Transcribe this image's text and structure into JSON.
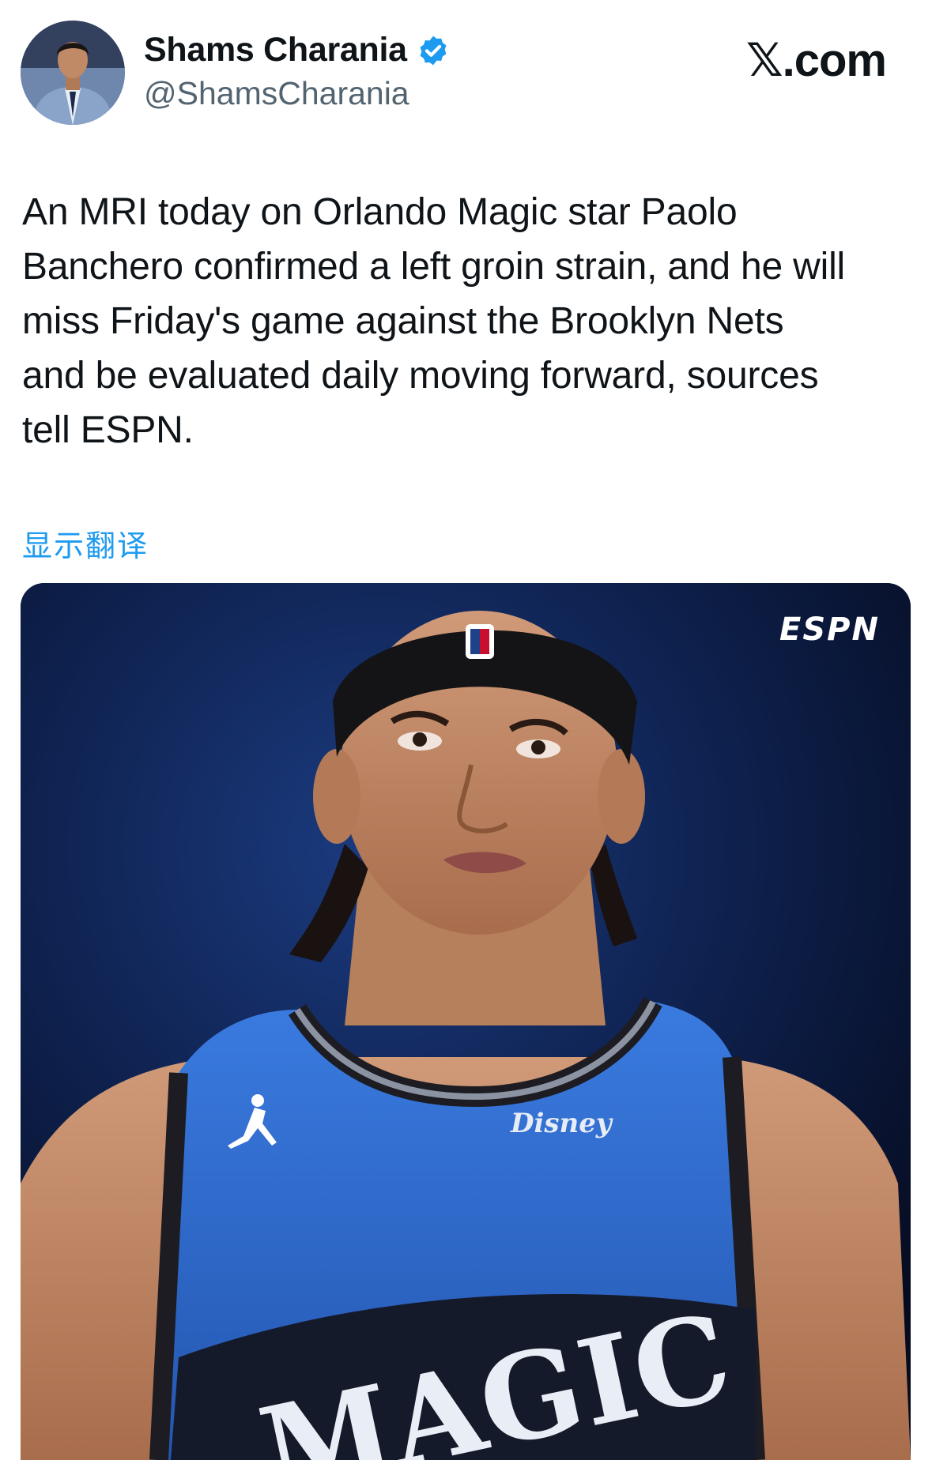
{
  "tweet": {
    "author": {
      "display_name": "Shams Charania",
      "handle": "@ShamsCharania",
      "verified": true,
      "avatar_icon": "profile-photo"
    },
    "site_label": "𝕏.com",
    "text": "An MRI today on Orlando Magic star Paolo\nBanchero confirmed a left groin strain, and he will\nmiss Friday's game against the Brooklyn Nets\nand be evaluated daily moving forward, sources\ntell ESPN.",
    "translate_label": "显示翻译",
    "media": {
      "watermark": "ESPN",
      "jersey_sponsor": "Disney",
      "jersey_text": "MAGIC"
    }
  },
  "colors": {
    "link": "#1d9bf0",
    "verified": "#1d9bf0",
    "secondary_text": "#536471",
    "jersey_blue": "#2f6fd0"
  }
}
